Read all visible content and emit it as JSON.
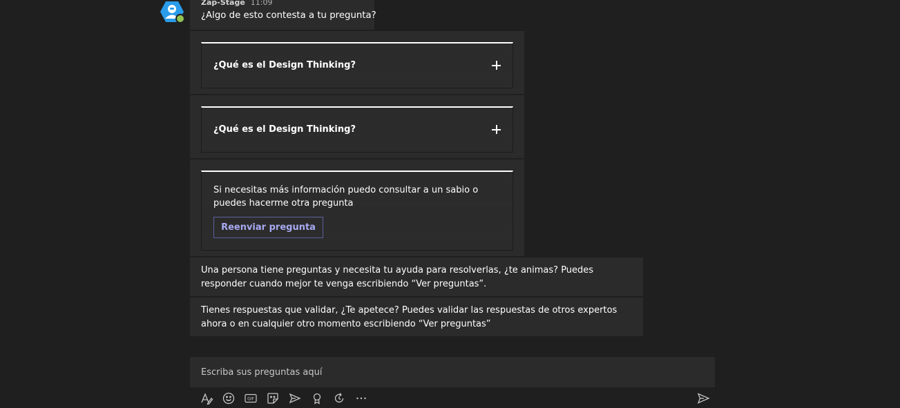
{
  "message": {
    "sender": "Zap-Stage",
    "time": "11:09",
    "intro": "¿Algo de esto contesta a tu pregunta?"
  },
  "faq_cards": [
    {
      "question": "¿Qué es el Design Thinking?",
      "expand_icon": "plus-icon"
    },
    {
      "question": "¿Qué es el Design Thinking?",
      "expand_icon": "plus-icon"
    }
  ],
  "info_card": {
    "text": "Si necesitas más información puedo consultar a un sabio o puedes hacerme otra pregunta",
    "button_label": "Reenviar pregunta"
  },
  "messages": [
    "Una persona tiene preguntas y necesita tu ayuda para resolverlas, ¿te animas? Puedes responder cuando mejor te venga escribiendo “Ver preguntas”.",
    "Tienes respuestas que validar, ¿Te apetece? Puedes validar las respuestas de otros expertos ahora o en cualquier otro momento escribiendo “Ver preguntas”"
  ],
  "compose": {
    "placeholder": "Escriba sus preguntas aquí"
  },
  "toolbar": {
    "icons": [
      "format-icon",
      "emoji-icon",
      "gif-icon",
      "sticker-icon",
      "meet-now-icon",
      "praise-icon",
      "loop-icon",
      "more-options-icon",
      "send-icon"
    ]
  },
  "colors": {
    "background": "#1f1f1f",
    "bubble": "#2b2b2b",
    "accent": "#a7a9f2",
    "presence": "#92c353",
    "avatar": "#2a9ceb"
  }
}
